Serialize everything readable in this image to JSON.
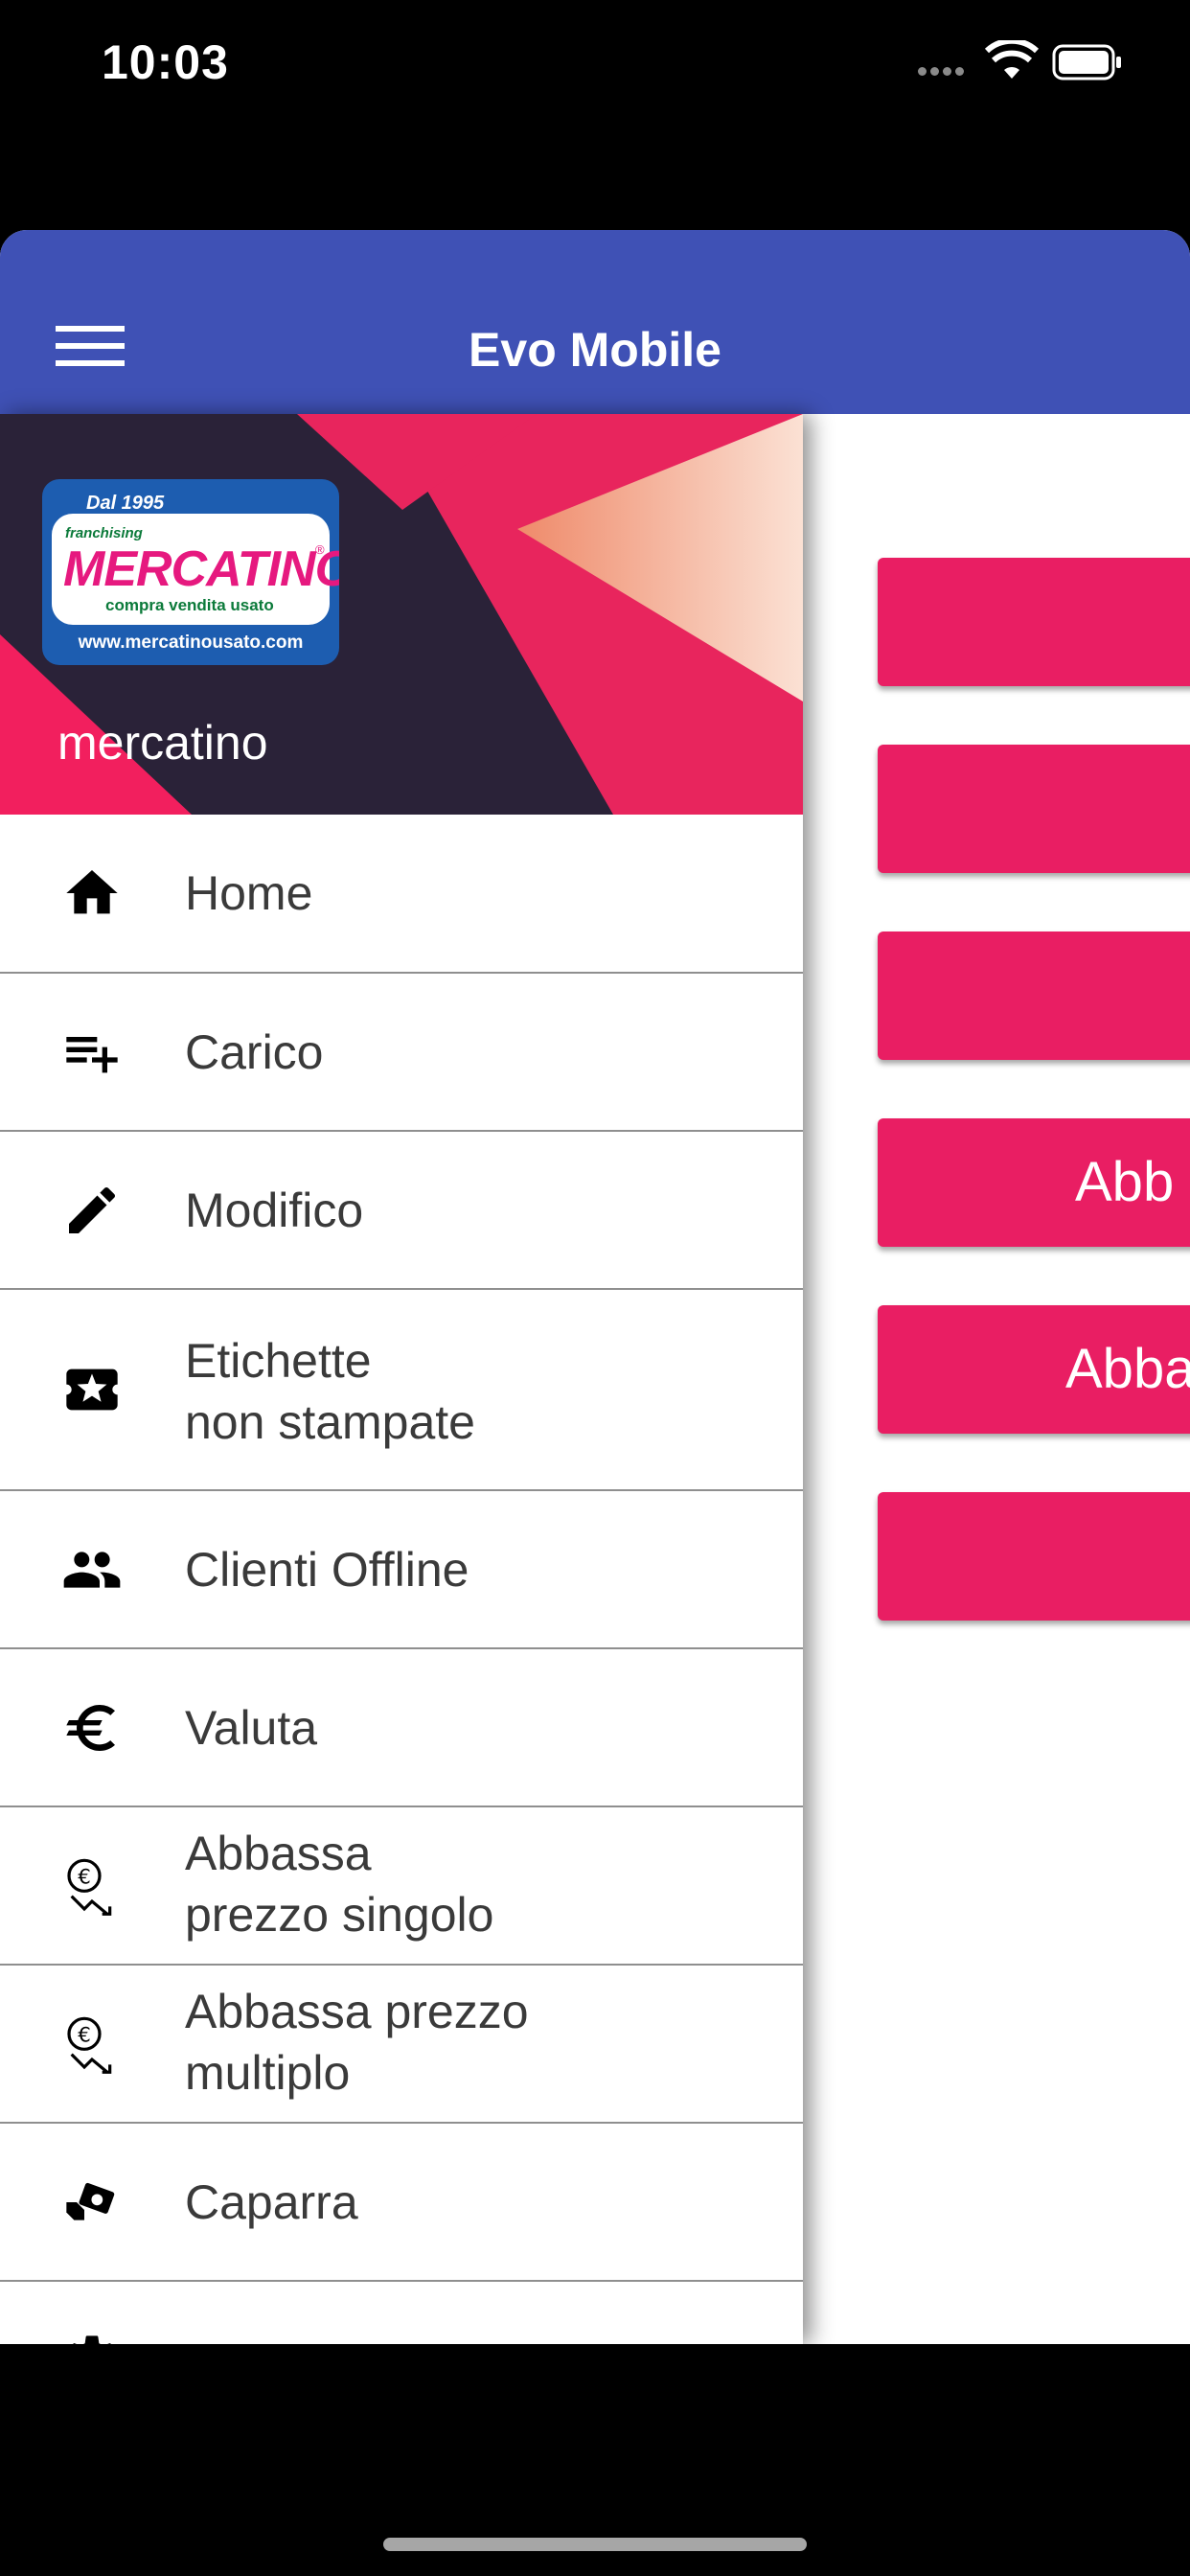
{
  "status_bar": {
    "time": "10:03"
  },
  "app_bar": {
    "title": "Evo Mobile",
    "menu_icon": "hamburger-menu-icon"
  },
  "drawer": {
    "logo": {
      "since": "Dal 1995",
      "franchising": "franchising",
      "brand": "MERCATINO",
      "registered": "®",
      "tagline": "compra vendita usato",
      "url": "www.mercatinousato.com"
    },
    "user_name": "mercatino",
    "items": [
      {
        "icon": "home-icon",
        "line1": "Home",
        "line2": ""
      },
      {
        "icon": "playlist-add-icon",
        "line1": "Carico",
        "line2": ""
      },
      {
        "icon": "pencil-icon",
        "line1": "Modifico",
        "line2": ""
      },
      {
        "icon": "ticket-star-icon",
        "line1": "Etichette",
        "line2": "non stampate"
      },
      {
        "icon": "people-icon",
        "line1": "Clienti Offline",
        "line2": ""
      },
      {
        "icon": "euro-icon",
        "line1": "Valuta",
        "line2": ""
      },
      {
        "icon": "price-down-icon",
        "line1": "Abbassa",
        "line2": "prezzo singolo"
      },
      {
        "icon": "price-down-icon",
        "line1": "Abbassa prezzo",
        "line2": "multiplo"
      },
      {
        "icon": "money-hand-icon",
        "line1": "Caparra",
        "line2": ""
      },
      {
        "icon": "gear-icon",
        "line1": "",
        "line2": ""
      }
    ]
  },
  "main_buttons": [
    "",
    "",
    "",
    "Abb",
    "Abba",
    ""
  ],
  "colors": {
    "app_bar": "#3f51b5",
    "accent": "#e91e63",
    "header_dark": "#2a2238"
  }
}
